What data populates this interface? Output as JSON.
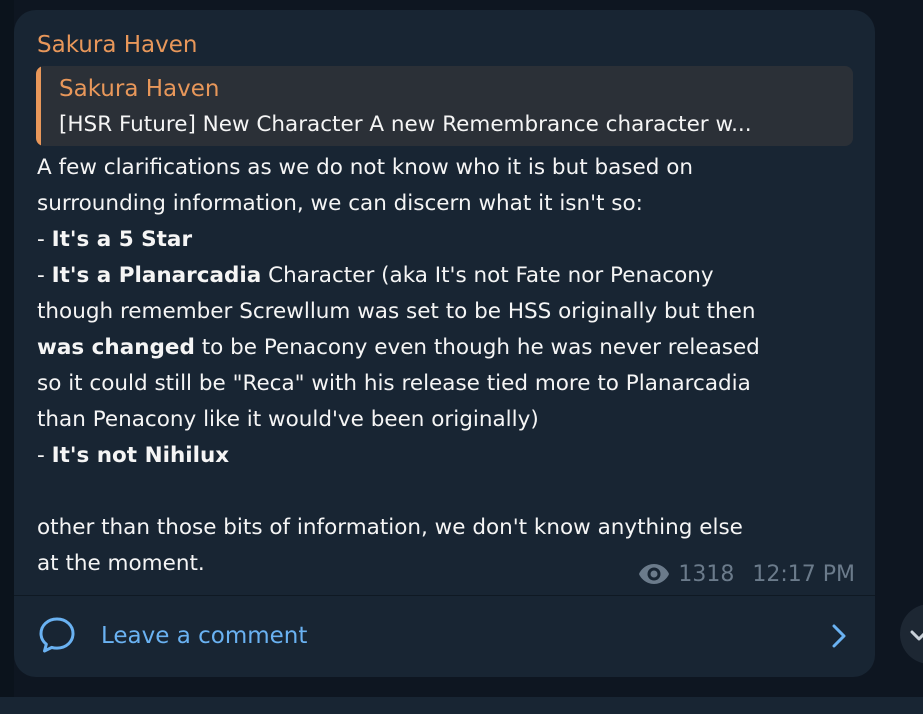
{
  "post": {
    "sender": "Sakura Haven",
    "reply": {
      "name": "Sakura Haven",
      "text": "[HSR Future] New Character  A new Remembrance character w..."
    },
    "lines": {
      "l1": "A few clarifications as we do not know who it is but based on",
      "l2": "surrounding information, we can discern what it isn't so:",
      "l3a": "- ",
      "l3b": "It's a 5 Star",
      "l4a": "- ",
      "l4b": "It's a Planarcadia",
      "l4c": " Character (aka It's not Fate nor Penacony",
      "l5": "though remember Screwllum was set to be HSS originally but then",
      "l6a": "was changed",
      "l6b": " to be Penacony even though he was never released",
      "l7": "so it could still be \"Reca\" with his release tied more to Planarcadia",
      "l8": "than Penacony like it would've been originally)",
      "l9a": "- ",
      "l9b": "It's not Nihilux",
      "l11": "other than those bits of information, we don't know anything else",
      "l12": "at the moment."
    },
    "views": "1318",
    "time": "12:17 PM"
  },
  "comments": {
    "label": "Leave a comment"
  },
  "icons": {
    "views": "eye-icon",
    "comment": "comment-bubble-icon",
    "open": "chevron-right-icon",
    "scroll": "scroll-down-icon"
  },
  "colors": {
    "background": "#0e1621",
    "bubble": "#182533",
    "sender": "#e8975a",
    "link": "#6ab2f2",
    "meta": "#6b7b8b",
    "text": "#f5f5f5"
  }
}
